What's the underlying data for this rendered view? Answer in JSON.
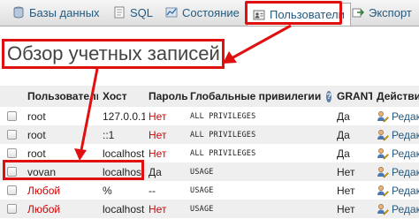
{
  "tabs": [
    {
      "label": "Базы данных",
      "icon": "database-icon"
    },
    {
      "label": "SQL",
      "icon": "sql-icon"
    },
    {
      "label": "Состояние",
      "icon": "status-icon"
    },
    {
      "label": "Пользователи",
      "icon": "users-icon",
      "active": true
    },
    {
      "label": "Экспорт",
      "icon": "export-icon"
    }
  ],
  "page": {
    "title": "Обзор учетных записей"
  },
  "table": {
    "headers": {
      "user": "Пользователь",
      "host": "Хост",
      "password": "Пароль",
      "privileges": "Глобальные привилегии",
      "grant": "GRANT",
      "action": "Действия"
    },
    "rows": [
      {
        "user": "root",
        "host": "127.0.0.1",
        "password": "Нет",
        "privileges": "ALL PRIVILEGES",
        "grant": "Да",
        "action": "Редактировать привилегии"
      },
      {
        "user": "root",
        "host": "::1",
        "password": "Нет",
        "privileges": "ALL PRIVILEGES",
        "grant": "Да",
        "action": "Редактировать привилегии"
      },
      {
        "user": "root",
        "host": "localhost",
        "password": "Нет",
        "privileges": "ALL PRIVILEGES",
        "grant": "Да",
        "action": "Редактировать привилегии"
      },
      {
        "user": "vovan",
        "host": "localhost",
        "password": "Да",
        "privileges": "USAGE",
        "grant": "Нет",
        "action": "Редактировать привилегии"
      },
      {
        "user": "Любой",
        "host": "%",
        "password": "--",
        "privileges": "USAGE",
        "grant": "Нет",
        "action": "Редактировать привилегии"
      },
      {
        "user": "Любой",
        "host": "localhost",
        "password": "Нет",
        "privileges": "USAGE",
        "grant": "Нет",
        "action": "Редактировать привилегии"
      }
    ]
  },
  "colors": {
    "highlight": "#e01010",
    "link": "#235a81",
    "negative": "#d40000"
  }
}
